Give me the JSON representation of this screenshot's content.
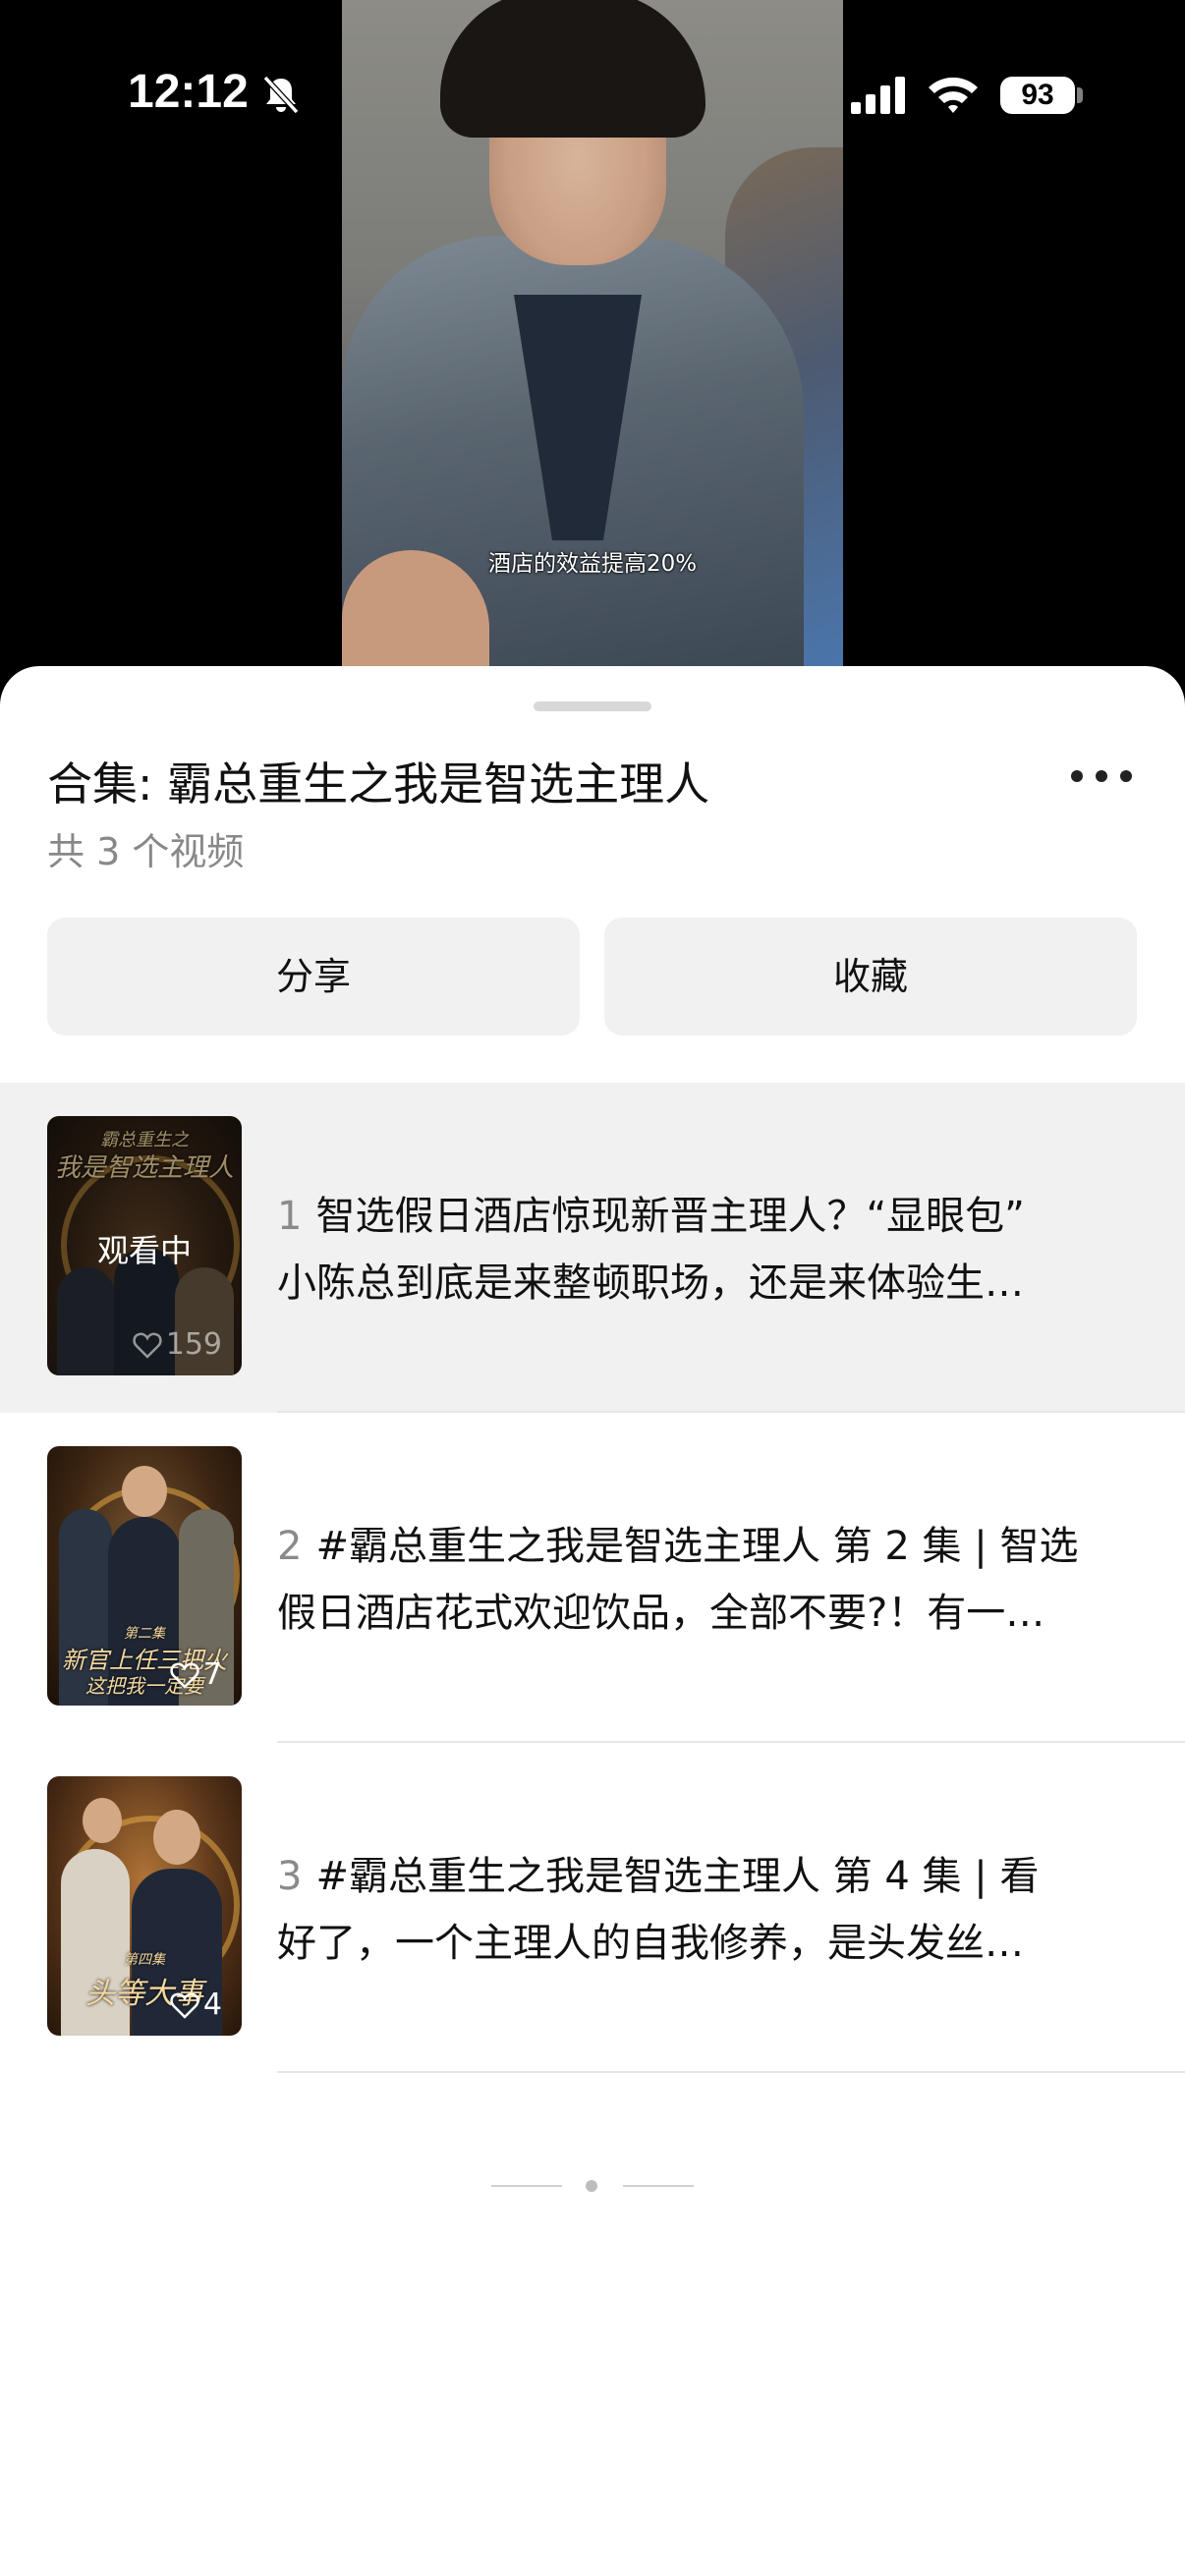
{
  "status_bar": {
    "time": "12:12",
    "battery": "93"
  },
  "video": {
    "subtitle": "酒店的效益提高20%"
  },
  "collection": {
    "title": "合集: 霸总重生之我是智选主理人",
    "count": "共 3 个视频",
    "share_label": "分享",
    "favorite_label": "收藏"
  },
  "episodes": [
    {
      "number": "1",
      "line1": "智选假日酒店惊现新晋主理人？“显眼包”",
      "line2": "小陈总到底是来整顿职场，还是来体验生…",
      "likes": "159",
      "status": "观看中",
      "cover_text_1": "霸总重生之",
      "cover_text_2": "我是智选主理人"
    },
    {
      "number": "2",
      "line1": "#霸总重生之我是智选主理人 第 2 集 | 智选",
      "line2": "假日酒店花式欢迎饮品，全部不要?！有一…",
      "likes": "7",
      "cover_text_1": "第二集",
      "cover_text_2": "新官上任三把火",
      "cover_text_3": "这把我一定要"
    },
    {
      "number": "3",
      "line1": "#霸总重生之我是智选主理人 第 4 集 | 看",
      "line2": "好了，一个主理人的自我修养，是头发丝…",
      "likes": "4",
      "cover_text_1": "第四集",
      "cover_text_2": "头等大事"
    }
  ],
  "colors": {
    "sheet_bg": "#ffffff",
    "active_row_bg": "#f1f1f1",
    "button_bg": "#f1f1f1",
    "secondary_text": "#888888"
  }
}
